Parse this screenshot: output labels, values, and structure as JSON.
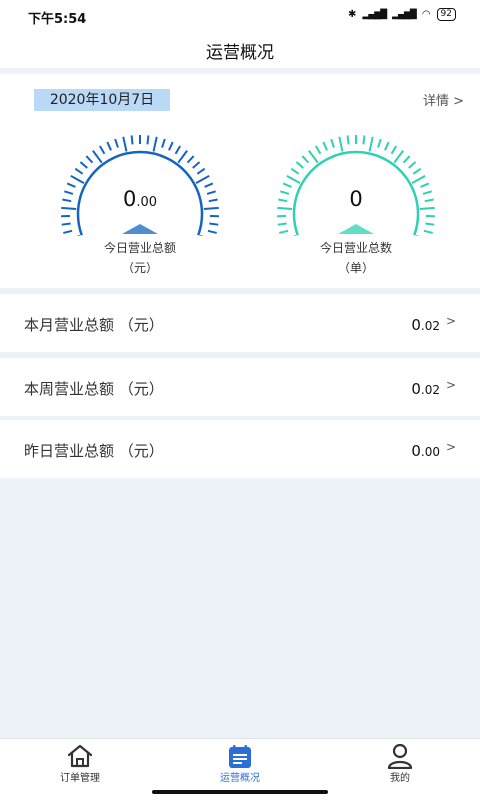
{
  "status": {
    "time": "下午5:54",
    "battery": "92"
  },
  "title": "运营概况",
  "overview": {
    "date": "2020年10月7日",
    "details": "详情 >",
    "gauges": [
      {
        "value_main": "0",
        "value_decimal": ".00",
        "label": "今日营业总额",
        "unit": "（元）",
        "color": "#1565c0",
        "fill_fraction": 0
      },
      {
        "value_main": "0",
        "value_decimal": "",
        "label": "今日营业总数",
        "unit": "（单）",
        "color": "#2ed1b3",
        "fill_fraction": 0
      }
    ]
  },
  "rows": [
    {
      "label": "本月营业总额 （元）",
      "value_main": "0",
      "value_decimal": ".02",
      "chevron": ">"
    },
    {
      "label": "本周营业总额 （元）",
      "value_main": "0",
      "value_decimal": ".02",
      "chevron": ">"
    },
    {
      "label": "昨日营业总额 （元）",
      "value_main": "0",
      "value_decimal": ".00",
      "chevron": ">"
    }
  ],
  "tabs": [
    {
      "label": "订单管理",
      "icon": "home-icon"
    },
    {
      "label": "运营概况",
      "icon": "report-icon",
      "active": true
    },
    {
      "label": "我的",
      "icon": "user-icon"
    }
  ],
  "colors": {
    "accent": "#2b6fd6",
    "date_badge": "#b9d9f7",
    "background": "#edf1f8"
  }
}
